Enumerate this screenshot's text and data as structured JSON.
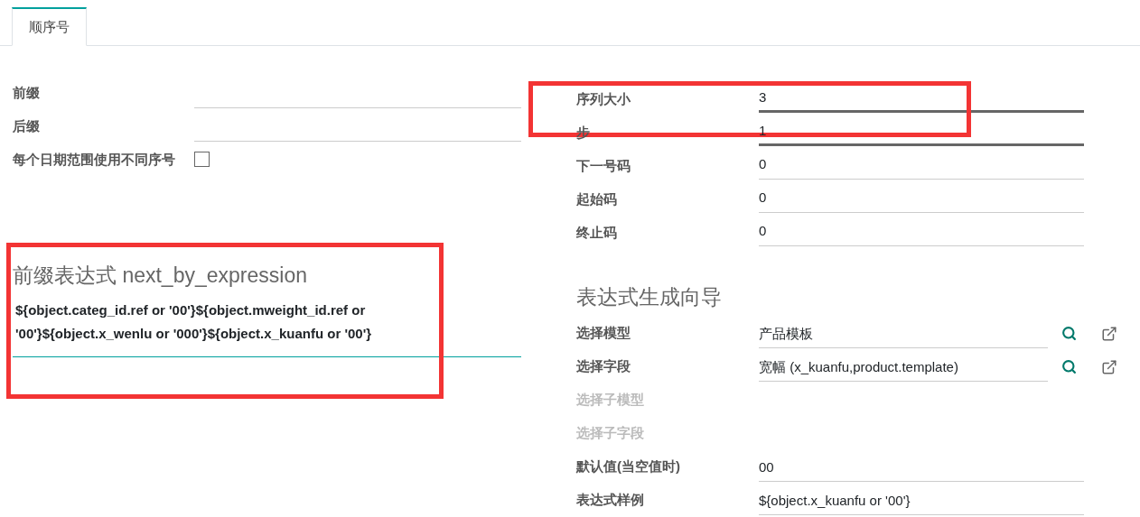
{
  "tabs": [
    {
      "label": "顺序号",
      "selected": true
    }
  ],
  "left_fields": [
    {
      "label": "前缀",
      "kind": "text"
    },
    {
      "label": "后缀",
      "kind": "text"
    },
    {
      "label": "每个日期范围使用不同序号",
      "kind": "checkbox",
      "checked": false
    }
  ],
  "right_fields": [
    {
      "label": "序列大小",
      "value": "3",
      "emphasized": true,
      "annotated": true
    },
    {
      "label": "步",
      "value": "1",
      "emphasized": true,
      "annotated": false
    },
    {
      "label": "下一号码",
      "value": "0",
      "emphasized": false,
      "annotated": false
    },
    {
      "label": "起始码",
      "value": "0",
      "emphasized": false,
      "annotated": false
    },
    {
      "label": "终止码",
      "value": "0",
      "emphasized": false,
      "annotated": false
    }
  ],
  "expression": {
    "title": "前缀表达式 next_by_expression",
    "value": "${object.categ_id.ref or '00'}${object.mweight_id.ref or '00'}${object.x_wenlu or '000'}${object.x_kuanfu or '00'}",
    "annotated": true
  },
  "wizard": {
    "title": "表达式生成向导",
    "fields": [
      {
        "label": "选择模型",
        "kind": "many2one",
        "value": "产品模板",
        "disabled": false
      },
      {
        "label": "选择字段",
        "kind": "many2one",
        "value": "宽幅 (x_kuanfu,product.template)",
        "disabled": false
      },
      {
        "label": "选择子模型",
        "kind": "hidden",
        "disabled": true
      },
      {
        "label": "选择子字段",
        "kind": "hidden",
        "disabled": true
      },
      {
        "label": "默认值(当空值时)",
        "kind": "text",
        "value": "00",
        "disabled": false
      },
      {
        "label": "表达式样例",
        "kind": "text",
        "value": "${object.x_kuanfu or '00'}",
        "disabled": false
      }
    ]
  }
}
